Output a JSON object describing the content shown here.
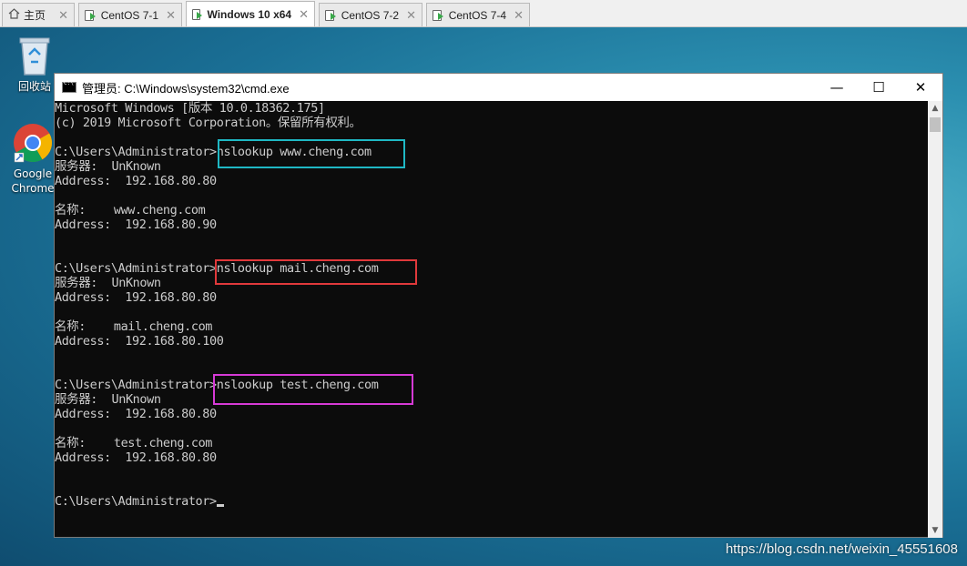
{
  "tabs": [
    {
      "label": "主页",
      "icon": "home-icon",
      "active": false
    },
    {
      "label": "CentOS 7-1",
      "icon": "vm-icon",
      "active": false
    },
    {
      "label": "Windows 10 x64",
      "icon": "vm-icon",
      "active": true
    },
    {
      "label": "CentOS 7-2",
      "icon": "vm-icon",
      "active": false
    },
    {
      "label": "CentOS 7-4",
      "icon": "vm-icon",
      "active": false
    }
  ],
  "tab_close": "✕",
  "desktop": {
    "recycle_label": "回收站",
    "chrome_label_1": "Google",
    "chrome_label_2": "Chrome"
  },
  "window": {
    "title": "管理员: C:\\Windows\\system32\\cmd.exe",
    "minimize": "—",
    "maximize": "☐",
    "close": "✕"
  },
  "console_lines": [
    "Microsoft Windows [版本 10.0.18362.175]",
    "(c) 2019 Microsoft Corporation。保留所有权利。",
    "",
    "C:\\Users\\Administrator>nslookup www.cheng.com",
    "服务器:  UnKnown",
    "Address:  192.168.80.80",
    "",
    "名称:    www.cheng.com",
    "Address:  192.168.80.90",
    "",
    "",
    "C:\\Users\\Administrator>nslookup mail.cheng.com",
    "服务器:  UnKnown",
    "Address:  192.168.80.80",
    "",
    "名称:    mail.cheng.com",
    "Address:  192.168.80.100",
    "",
    "",
    "C:\\Users\\Administrator>nslookup test.cheng.com",
    "服务器:  UnKnown",
    "Address:  192.168.80.80",
    "",
    "名称:    test.cheng.com",
    "Address:  192.168.80.80",
    "",
    "",
    "C:\\Users\\Administrator>"
  ],
  "highlight_colors": {
    "www": "#1fb8c4",
    "mail": "#e0393b",
    "test": "#d63ad6"
  },
  "watermark": "https://blog.csdn.net/weixin_45551608"
}
